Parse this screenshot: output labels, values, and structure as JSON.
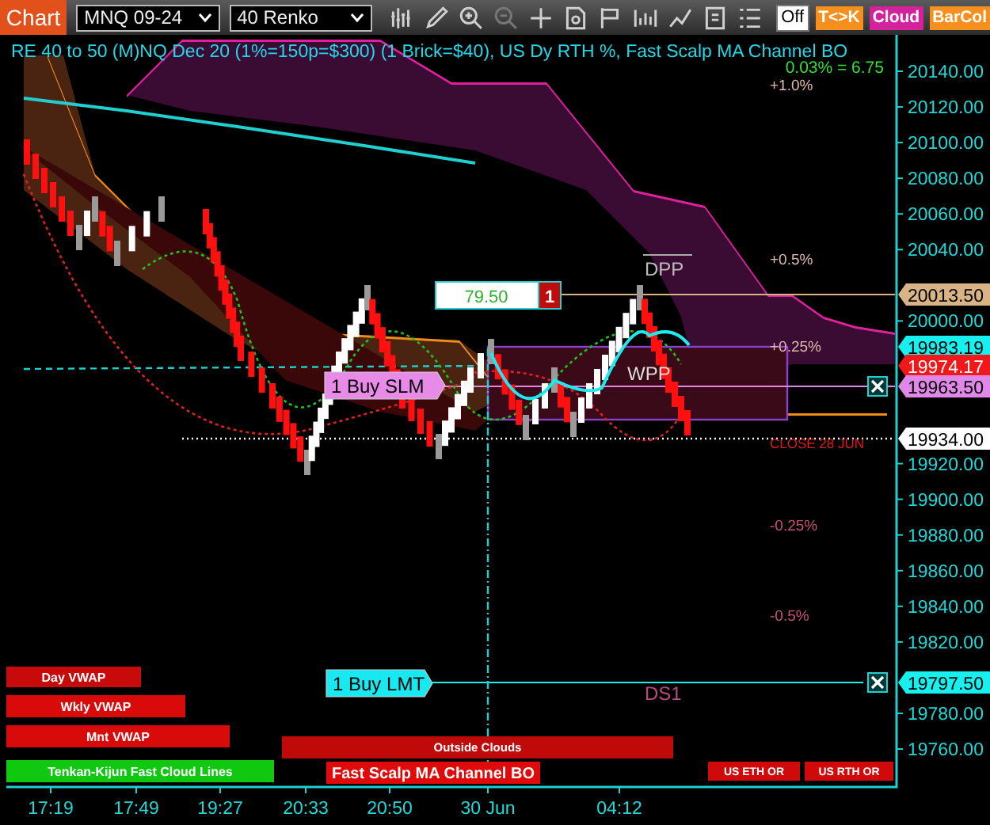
{
  "toolbar": {
    "title": "Chart",
    "instrument": "MNQ 09-24",
    "bar_type": "40 Renko",
    "mode": "Off",
    "buttons": [
      {
        "label": "T<>K",
        "color": "#f5901e"
      },
      {
        "label": "Cloud",
        "color": "#d4229c"
      },
      {
        "label": "BarCol",
        "color": "#f5901e"
      }
    ]
  },
  "chart": {
    "title": "RE 40 to 50 (M)NQ Dec 20 (1%=150p=$300) (1 Brick=$40), US Dy RTH %, Fast Scalp MA Channel BO",
    "brick_info": "0.03% = 6.75",
    "percent_levels": [
      {
        "label": "+1.0%",
        "color": "#e0b8a8"
      },
      {
        "label": "+0.5%",
        "color": "#e0b8a8"
      },
      {
        "label": "+0.25%",
        "color": "#e0b8a8"
      },
      {
        "label": "-0.25%",
        "color": "#c8507a"
      },
      {
        "label": "-0.5%",
        "color": "#c8507a"
      }
    ],
    "pivots": [
      {
        "label": "DPP"
      },
      {
        "label": "WPP"
      },
      {
        "label": "DS1"
      },
      {
        "label": "CLOSE 28 JUN"
      }
    ],
    "position": {
      "price": "79.50",
      "quantity": "1"
    },
    "orders": [
      {
        "label": "1 Buy SLM",
        "color": "#e88ae8"
      },
      {
        "label": "1 Buy LMT",
        "color": "#18e8f0"
      }
    ],
    "price_axis": [
      "20140.00",
      "20120.00",
      "20100.00",
      "20080.00",
      "20060.00",
      "20040.00",
      "20000.00",
      "19920.00",
      "19900.00",
      "19880.00",
      "19860.00",
      "19840.00",
      "19820.00",
      "19780.00",
      "19760.00"
    ],
    "price_markers": [
      {
        "label": "20013.50",
        "color": "#d8b484"
      },
      {
        "label": "19983.19",
        "color": "#18f0f0"
      },
      {
        "label": "19974.17",
        "color": "#f01818"
      },
      {
        "label": "19963.50",
        "color": "#e088e8"
      },
      {
        "label": "19934.00",
        "color": "#ffffff"
      },
      {
        "label": "19797.50",
        "color": "#18f0f0"
      }
    ],
    "indicator_buttons": [
      {
        "label": "Day VWAP",
        "color": "#c80a0a"
      },
      {
        "label": "Wkly VWAP",
        "color": "#d80a0a"
      },
      {
        "label": "Mnt VWAP",
        "color": "#d80a0a"
      },
      {
        "label": "Tenkan-Kijun Fast Cloud Lines",
        "color": "#10c810"
      },
      {
        "label": "Outside Clouds",
        "color": "#c00a0a"
      },
      {
        "label": "Fast Scalp MA Channel BO",
        "color": "#e00a0a"
      },
      {
        "label": "US ETH OR",
        "color": "#d00a0a"
      },
      {
        "label": "US RTH OR",
        "color": "#d00a0a"
      }
    ],
    "time_axis": [
      "17:19",
      "17:49",
      "19:27",
      "20:33",
      "20:50",
      "30 Jun",
      "04:12"
    ]
  }
}
